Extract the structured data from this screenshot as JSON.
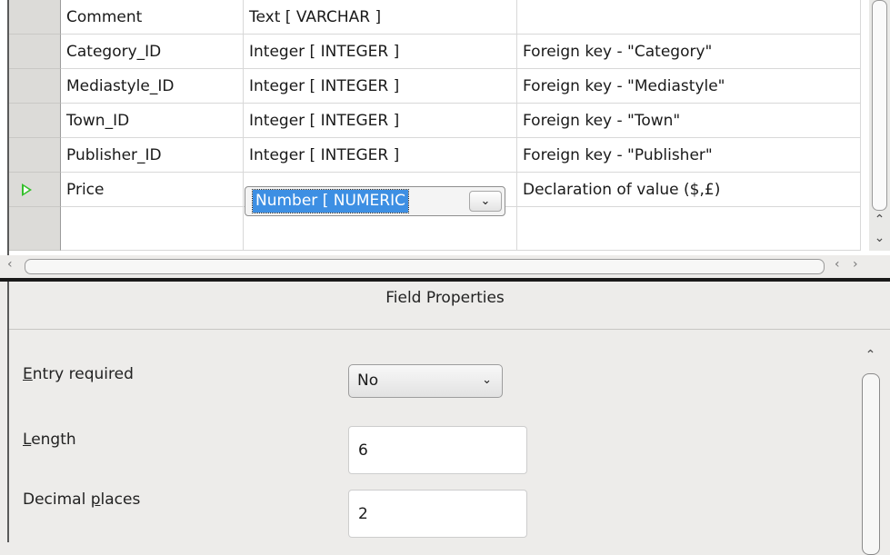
{
  "table_rows": [
    {
      "name": "Comment",
      "type": "Text [ VARCHAR ]",
      "description": ""
    },
    {
      "name": "Category_ID",
      "type": "Integer [ INTEGER ]",
      "description": "Foreign key - \"Category\""
    },
    {
      "name": "Mediastyle_ID",
      "type": "Integer [ INTEGER ]",
      "description": "Foreign key - \"Mediastyle\""
    },
    {
      "name": "Town_ID",
      "type": "Integer [ INTEGER ]",
      "description": "Foreign key - \"Town\""
    },
    {
      "name": "Publisher_ID",
      "type": "Integer [ INTEGER ]",
      "description": "Foreign key - \"Publisher\""
    },
    {
      "name": "Price",
      "type": "Number [ NUMERIC",
      "description": "Declaration of value ($,£)"
    },
    {
      "name": "",
      "type": "",
      "description": ""
    }
  ],
  "active_row_index": 5,
  "field_properties": {
    "title": "Field Properties",
    "entry_required": {
      "label_mnemonic": "E",
      "label_rest": "ntry required",
      "value": "No"
    },
    "length": {
      "label_mnemonic": "L",
      "label_rest": "ength",
      "value": "6"
    },
    "decimal_places": {
      "label_before": "Decimal ",
      "label_mnemonic": "p",
      "label_after": "laces",
      "value": "2"
    }
  },
  "icons": {
    "row_pointer": "green-triangle",
    "dropdown": "chevron-down",
    "scroll_up": "chevron-up",
    "scroll_down": "chevron-down",
    "scroll_left": "chevron-left",
    "scroll_right": "chevron-right"
  },
  "colors": {
    "selection": "#3d8fe3",
    "row_pointer": "#35c02c"
  }
}
